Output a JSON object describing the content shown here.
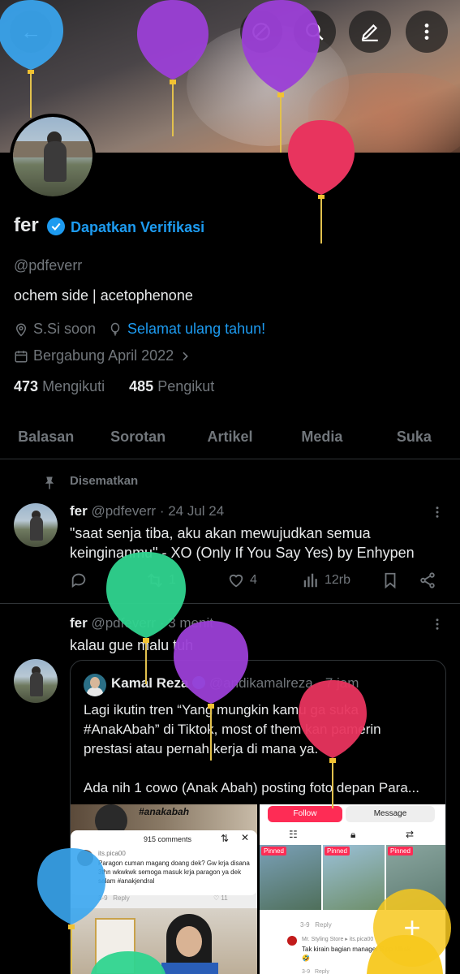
{
  "header": {
    "back_label": "←",
    "icons": [
      "no-bell-icon",
      "search-icon",
      "edit-icon",
      "more-icon"
    ]
  },
  "profile": {
    "name": "fer",
    "verify_cta": "Dapatkan Verifikasi",
    "handle": "@pdfeverr",
    "bio": "ochem side | acetophenone",
    "location": "S.Si soon",
    "birthday": "Selamat ulang tahun!",
    "joined": "Bergabung April 2022",
    "following_count": "473",
    "following_label": "Mengikuti",
    "followers_count": "485",
    "followers_label": "Pengikut"
  },
  "tabs": [
    "Balasan",
    "Sorotan",
    "Artikel",
    "Media",
    "Suka"
  ],
  "pinned": {
    "label": "Disematkan",
    "author": "fer",
    "handle": "@pdfeverr",
    "time": "· 24 Jul 24",
    "text_line1": "\"saat senja tiba, aku akan mewujudkan semua",
    "text_line2": "keinginanmu\" - XO (Only If You Say Yes) by Enhypen",
    "retweets": "1",
    "likes": "4",
    "views": "12rb"
  },
  "tweet2": {
    "author": "fer",
    "handle": "@pdfeverr",
    "time": "· 3 menit",
    "text": "kalau gue malu tuh",
    "quote": {
      "author": "Kamal Reza",
      "handle": "@andikamalreza",
      "time": "· 7 jam",
      "line1": "Lagi ikutin tren “Yang mungkin kamu ga suka",
      "line2": "#AnakAbah” di Tiktok, most of them kan pamerin",
      "line3": "prestasi atau pernah kerja di mana ya.",
      "line4": "Ada nih 1 cowo (Anak Abah) posting foto depan Para..."
    },
    "media_left": {
      "hashtag": "#anakabah",
      "comments": "915 comments",
      "commenter": "its.pica00",
      "comment": "Paragon cuman magang doang dek? Gw krja disana 3thn wkwkwk semoga masuk krja paragon ya dek salam #anakjendral",
      "age": "3-9",
      "reply": "Reply",
      "likes": "11"
    },
    "media_right": {
      "follow": "Follow",
      "message": "Message",
      "pinned": "Pinned",
      "reply": "Reply",
      "age1": "3-9",
      "store": "Mr. Styling Store ▸ its.pica00",
      "store_comment": "Tak kirain bagian manager Sipp Mbak 🤣",
      "age2": "3-9"
    }
  },
  "fab_label": "+",
  "colors": {
    "accent": "#1d9bf0",
    "muted": "#71767b",
    "text": "#e7e9ea",
    "balloon_purple": "#9b3fd6",
    "balloon_red": "#e8345e",
    "balloon_green": "#2fd48f",
    "balloon_blue": "#3aa6f0",
    "balloon_yellow": "#f7c81e"
  }
}
